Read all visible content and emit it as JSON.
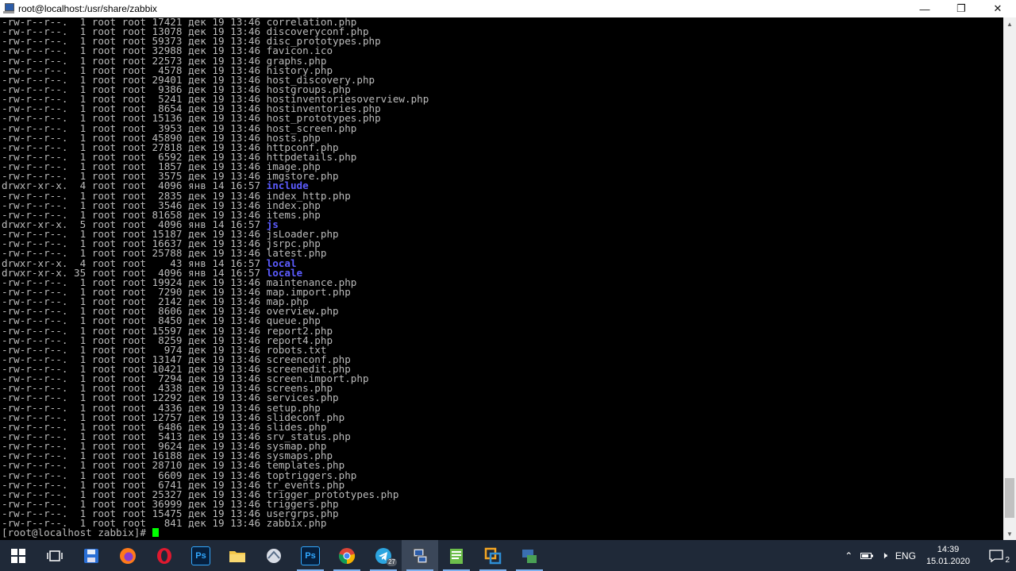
{
  "window": {
    "title": "root@localhost:/usr/share/zabbix",
    "controls": {
      "minimize": "—",
      "maximize": "❐",
      "close": "✕"
    }
  },
  "terminal": {
    "lines": [
      {
        "perms": "-rw-r--r--.",
        "links": "1",
        "owner": "root",
        "group": "root",
        "size": "17421",
        "month": "дек",
        "day": "19",
        "time": "13:46",
        "name": "correlation.php",
        "dir": false
      },
      {
        "perms": "-rw-r--r--.",
        "links": "1",
        "owner": "root",
        "group": "root",
        "size": "13078",
        "month": "дек",
        "day": "19",
        "time": "13:46",
        "name": "discoveryconf.php",
        "dir": false
      },
      {
        "perms": "-rw-r--r--.",
        "links": "1",
        "owner": "root",
        "group": "root",
        "size": "59373",
        "month": "дек",
        "day": "19",
        "time": "13:46",
        "name": "disc_prototypes.php",
        "dir": false
      },
      {
        "perms": "-rw-r--r--.",
        "links": "1",
        "owner": "root",
        "group": "root",
        "size": "32988",
        "month": "дек",
        "day": "19",
        "time": "13:46",
        "name": "favicon.ico",
        "dir": false
      },
      {
        "perms": "-rw-r--r--.",
        "links": "1",
        "owner": "root",
        "group": "root",
        "size": "22573",
        "month": "дек",
        "day": "19",
        "time": "13:46",
        "name": "graphs.php",
        "dir": false
      },
      {
        "perms": "-rw-r--r--.",
        "links": "1",
        "owner": "root",
        "group": "root",
        "size": "4578",
        "month": "дек",
        "day": "19",
        "time": "13:46",
        "name": "history.php",
        "dir": false
      },
      {
        "perms": "-rw-r--r--.",
        "links": "1",
        "owner": "root",
        "group": "root",
        "size": "29401",
        "month": "дек",
        "day": "19",
        "time": "13:46",
        "name": "host_discovery.php",
        "dir": false
      },
      {
        "perms": "-rw-r--r--.",
        "links": "1",
        "owner": "root",
        "group": "root",
        "size": "9386",
        "month": "дек",
        "day": "19",
        "time": "13:46",
        "name": "hostgroups.php",
        "dir": false
      },
      {
        "perms": "-rw-r--r--.",
        "links": "1",
        "owner": "root",
        "group": "root",
        "size": "5241",
        "month": "дек",
        "day": "19",
        "time": "13:46",
        "name": "hostinventoriesoverview.php",
        "dir": false
      },
      {
        "perms": "-rw-r--r--.",
        "links": "1",
        "owner": "root",
        "group": "root",
        "size": "8654",
        "month": "дек",
        "day": "19",
        "time": "13:46",
        "name": "hostinventories.php",
        "dir": false
      },
      {
        "perms": "-rw-r--r--.",
        "links": "1",
        "owner": "root",
        "group": "root",
        "size": "15136",
        "month": "дек",
        "day": "19",
        "time": "13:46",
        "name": "host_prototypes.php",
        "dir": false
      },
      {
        "perms": "-rw-r--r--.",
        "links": "1",
        "owner": "root",
        "group": "root",
        "size": "3953",
        "month": "дек",
        "day": "19",
        "time": "13:46",
        "name": "host_screen.php",
        "dir": false
      },
      {
        "perms": "-rw-r--r--.",
        "links": "1",
        "owner": "root",
        "group": "root",
        "size": "45890",
        "month": "дек",
        "day": "19",
        "time": "13:46",
        "name": "hosts.php",
        "dir": false
      },
      {
        "perms": "-rw-r--r--.",
        "links": "1",
        "owner": "root",
        "group": "root",
        "size": "27818",
        "month": "дек",
        "day": "19",
        "time": "13:46",
        "name": "httpconf.php",
        "dir": false
      },
      {
        "perms": "-rw-r--r--.",
        "links": "1",
        "owner": "root",
        "group": "root",
        "size": "6592",
        "month": "дек",
        "day": "19",
        "time": "13:46",
        "name": "httpdetails.php",
        "dir": false
      },
      {
        "perms": "-rw-r--r--.",
        "links": "1",
        "owner": "root",
        "group": "root",
        "size": "1857",
        "month": "дек",
        "day": "19",
        "time": "13:46",
        "name": "image.php",
        "dir": false
      },
      {
        "perms": "-rw-r--r--.",
        "links": "1",
        "owner": "root",
        "group": "root",
        "size": "3575",
        "month": "дек",
        "day": "19",
        "time": "13:46",
        "name": "imgstore.php",
        "dir": false
      },
      {
        "perms": "drwxr-xr-x.",
        "links": "4",
        "owner": "root",
        "group": "root",
        "size": "4096",
        "month": "янв",
        "day": "14",
        "time": "16:57",
        "name": "include",
        "dir": true
      },
      {
        "perms": "-rw-r--r--.",
        "links": "1",
        "owner": "root",
        "group": "root",
        "size": "2835",
        "month": "дек",
        "day": "19",
        "time": "13:46",
        "name": "index_http.php",
        "dir": false
      },
      {
        "perms": "-rw-r--r--.",
        "links": "1",
        "owner": "root",
        "group": "root",
        "size": "3546",
        "month": "дек",
        "day": "19",
        "time": "13:46",
        "name": "index.php",
        "dir": false
      },
      {
        "perms": "-rw-r--r--.",
        "links": "1",
        "owner": "root",
        "group": "root",
        "size": "81658",
        "month": "дек",
        "day": "19",
        "time": "13:46",
        "name": "items.php",
        "dir": false
      },
      {
        "perms": "drwxr-xr-x.",
        "links": "5",
        "owner": "root",
        "group": "root",
        "size": "4096",
        "month": "янв",
        "day": "14",
        "time": "16:57",
        "name": "js",
        "dir": true
      },
      {
        "perms": "-rw-r--r--.",
        "links": "1",
        "owner": "root",
        "group": "root",
        "size": "15187",
        "month": "дек",
        "day": "19",
        "time": "13:46",
        "name": "jsLoader.php",
        "dir": false
      },
      {
        "perms": "-rw-r--r--.",
        "links": "1",
        "owner": "root",
        "group": "root",
        "size": "16637",
        "month": "дек",
        "day": "19",
        "time": "13:46",
        "name": "jsrpc.php",
        "dir": false
      },
      {
        "perms": "-rw-r--r--.",
        "links": "1",
        "owner": "root",
        "group": "root",
        "size": "25788",
        "month": "дек",
        "day": "19",
        "time": "13:46",
        "name": "latest.php",
        "dir": false
      },
      {
        "perms": "drwxr-xr-x.",
        "links": "4",
        "owner": "root",
        "group": "root",
        "size": "43",
        "month": "янв",
        "day": "14",
        "time": "16:57",
        "name": "local",
        "dir": true
      },
      {
        "perms": "drwxr-xr-x.",
        "links": "35",
        "owner": "root",
        "group": "root",
        "size": "4096",
        "month": "янв",
        "day": "14",
        "time": "16:57",
        "name": "locale",
        "dir": true
      },
      {
        "perms": "-rw-r--r--.",
        "links": "1",
        "owner": "root",
        "group": "root",
        "size": "19924",
        "month": "дек",
        "day": "19",
        "time": "13:46",
        "name": "maintenance.php",
        "dir": false
      },
      {
        "perms": "-rw-r--r--.",
        "links": "1",
        "owner": "root",
        "group": "root",
        "size": "7290",
        "month": "дек",
        "day": "19",
        "time": "13:46",
        "name": "map.import.php",
        "dir": false
      },
      {
        "perms": "-rw-r--r--.",
        "links": "1",
        "owner": "root",
        "group": "root",
        "size": "2142",
        "month": "дек",
        "day": "19",
        "time": "13:46",
        "name": "map.php",
        "dir": false
      },
      {
        "perms": "-rw-r--r--.",
        "links": "1",
        "owner": "root",
        "group": "root",
        "size": "8606",
        "month": "дек",
        "day": "19",
        "time": "13:46",
        "name": "overview.php",
        "dir": false
      },
      {
        "perms": "-rw-r--r--.",
        "links": "1",
        "owner": "root",
        "group": "root",
        "size": "8450",
        "month": "дек",
        "day": "19",
        "time": "13:46",
        "name": "queue.php",
        "dir": false
      },
      {
        "perms": "-rw-r--r--.",
        "links": "1",
        "owner": "root",
        "group": "root",
        "size": "15597",
        "month": "дек",
        "day": "19",
        "time": "13:46",
        "name": "report2.php",
        "dir": false
      },
      {
        "perms": "-rw-r--r--.",
        "links": "1",
        "owner": "root",
        "group": "root",
        "size": "8259",
        "month": "дек",
        "day": "19",
        "time": "13:46",
        "name": "report4.php",
        "dir": false
      },
      {
        "perms": "-rw-r--r--.",
        "links": "1",
        "owner": "root",
        "group": "root",
        "size": "974",
        "month": "дек",
        "day": "19",
        "time": "13:46",
        "name": "robots.txt",
        "dir": false
      },
      {
        "perms": "-rw-r--r--.",
        "links": "1",
        "owner": "root",
        "group": "root",
        "size": "13147",
        "month": "дек",
        "day": "19",
        "time": "13:46",
        "name": "screenconf.php",
        "dir": false
      },
      {
        "perms": "-rw-r--r--.",
        "links": "1",
        "owner": "root",
        "group": "root",
        "size": "10421",
        "month": "дек",
        "day": "19",
        "time": "13:46",
        "name": "screenedit.php",
        "dir": false
      },
      {
        "perms": "-rw-r--r--.",
        "links": "1",
        "owner": "root",
        "group": "root",
        "size": "7294",
        "month": "дек",
        "day": "19",
        "time": "13:46",
        "name": "screen.import.php",
        "dir": false
      },
      {
        "perms": "-rw-r--r--.",
        "links": "1",
        "owner": "root",
        "group": "root",
        "size": "4338",
        "month": "дек",
        "day": "19",
        "time": "13:46",
        "name": "screens.php",
        "dir": false
      },
      {
        "perms": "-rw-r--r--.",
        "links": "1",
        "owner": "root",
        "group": "root",
        "size": "12292",
        "month": "дек",
        "day": "19",
        "time": "13:46",
        "name": "services.php",
        "dir": false
      },
      {
        "perms": "-rw-r--r--.",
        "links": "1",
        "owner": "root",
        "group": "root",
        "size": "4336",
        "month": "дек",
        "day": "19",
        "time": "13:46",
        "name": "setup.php",
        "dir": false
      },
      {
        "perms": "-rw-r--r--.",
        "links": "1",
        "owner": "root",
        "group": "root",
        "size": "12757",
        "month": "дек",
        "day": "19",
        "time": "13:46",
        "name": "slideconf.php",
        "dir": false
      },
      {
        "perms": "-rw-r--r--.",
        "links": "1",
        "owner": "root",
        "group": "root",
        "size": "6486",
        "month": "дек",
        "day": "19",
        "time": "13:46",
        "name": "slides.php",
        "dir": false
      },
      {
        "perms": "-rw-r--r--.",
        "links": "1",
        "owner": "root",
        "group": "root",
        "size": "5413",
        "month": "дек",
        "day": "19",
        "time": "13:46",
        "name": "srv_status.php",
        "dir": false
      },
      {
        "perms": "-rw-r--r--.",
        "links": "1",
        "owner": "root",
        "group": "root",
        "size": "9624",
        "month": "дек",
        "day": "19",
        "time": "13:46",
        "name": "sysmap.php",
        "dir": false
      },
      {
        "perms": "-rw-r--r--.",
        "links": "1",
        "owner": "root",
        "group": "root",
        "size": "16188",
        "month": "дек",
        "day": "19",
        "time": "13:46",
        "name": "sysmaps.php",
        "dir": false
      },
      {
        "perms": "-rw-r--r--.",
        "links": "1",
        "owner": "root",
        "group": "root",
        "size": "28710",
        "month": "дек",
        "day": "19",
        "time": "13:46",
        "name": "templates.php",
        "dir": false
      },
      {
        "perms": "-rw-r--r--.",
        "links": "1",
        "owner": "root",
        "group": "root",
        "size": "6609",
        "month": "дек",
        "day": "19",
        "time": "13:46",
        "name": "toptriggers.php",
        "dir": false
      },
      {
        "perms": "-rw-r--r--.",
        "links": "1",
        "owner": "root",
        "group": "root",
        "size": "6741",
        "month": "дек",
        "day": "19",
        "time": "13:46",
        "name": "tr_events.php",
        "dir": false
      },
      {
        "perms": "-rw-r--r--.",
        "links": "1",
        "owner": "root",
        "group": "root",
        "size": "25327",
        "month": "дек",
        "day": "19",
        "time": "13:46",
        "name": "trigger_prototypes.php",
        "dir": false
      },
      {
        "perms": "-rw-r--r--.",
        "links": "1",
        "owner": "root",
        "group": "root",
        "size": "36999",
        "month": "дек",
        "day": "19",
        "time": "13:46",
        "name": "triggers.php",
        "dir": false
      },
      {
        "perms": "-rw-r--r--.",
        "links": "1",
        "owner": "root",
        "group": "root",
        "size": "15475",
        "month": "дек",
        "day": "19",
        "time": "13:46",
        "name": "usergrps.php",
        "dir": false
      },
      {
        "perms": "-rw-r--r--.",
        "links": "1",
        "owner": "root",
        "group": "root",
        "size": "841",
        "month": "дек",
        "day": "19",
        "time": "13:46",
        "name": "zabbix.php",
        "dir": false
      }
    ],
    "prompt": "[root@localhost zabbix]# ",
    "colors": {
      "text": "#bbbbbb",
      "directory": "#5c5cff",
      "cursor": "#00ff00",
      "background": "#000000"
    },
    "scroll_position": 0.98
  },
  "taskbar": {
    "apps": [
      {
        "name": "start",
        "icon": "windows-logo-icon",
        "active": false,
        "running": false
      },
      {
        "name": "task-view",
        "icon": "task-view-icon",
        "active": false,
        "running": false
      },
      {
        "name": "save",
        "icon": "floppy-disk-icon",
        "active": false,
        "running": false
      },
      {
        "name": "firefox",
        "icon": "firefox-icon",
        "active": false,
        "running": false
      },
      {
        "name": "opera",
        "icon": "opera-icon",
        "active": false,
        "running": false
      },
      {
        "name": "photoshop",
        "icon": "photoshop-icon",
        "label": "Ps",
        "active": false,
        "running": false
      },
      {
        "name": "file-explorer",
        "icon": "folder-icon",
        "active": false,
        "running": false
      },
      {
        "name": "network-tool",
        "icon": "network-tool-icon",
        "active": false,
        "running": false
      },
      {
        "name": "photoshop-2",
        "icon": "photoshop-icon",
        "label": "Ps",
        "active": false,
        "running": true
      },
      {
        "name": "chrome",
        "icon": "chrome-icon",
        "active": false,
        "running": true
      },
      {
        "name": "telegram",
        "icon": "telegram-icon",
        "badge": "27",
        "active": false,
        "running": true
      },
      {
        "name": "putty",
        "icon": "putty-icon",
        "active": true,
        "running": true
      },
      {
        "name": "notepad",
        "icon": "notepad-icon",
        "active": false,
        "running": true
      },
      {
        "name": "virtual-machine",
        "icon": "vm-icon",
        "active": false,
        "running": true
      },
      {
        "name": "remote-tool",
        "icon": "remote-tool-icon",
        "active": false,
        "running": true
      }
    ],
    "tray": {
      "language": "ENG",
      "time": "14:39",
      "date": "15.01.2020",
      "notification_count": "2"
    }
  }
}
